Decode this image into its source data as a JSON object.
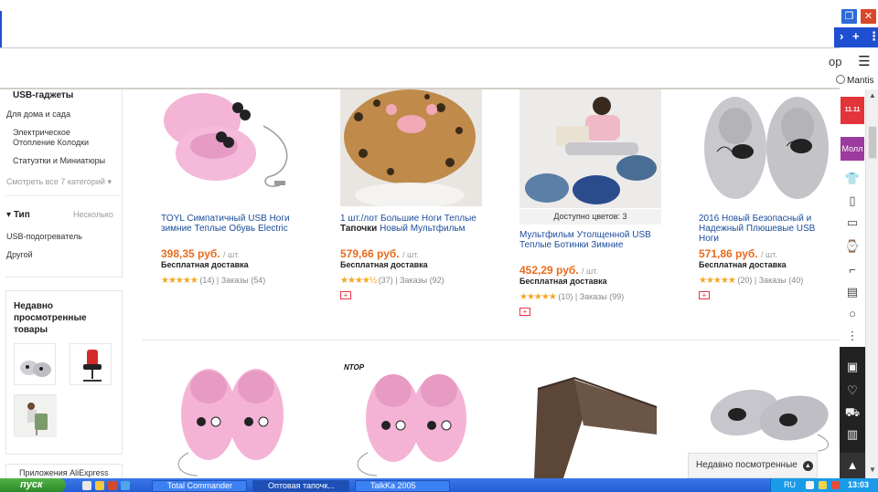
{
  "browser": {
    "menu_fragment": "ор",
    "restore_icon": "restore-icon",
    "close_icon": "close-icon",
    "nav": {
      "next": "›",
      "plus": "+",
      "more": "⋮"
    },
    "hamburger": "☰",
    "mantis_label": "Mantis",
    "accent": "#1f4fd1"
  },
  "left_filters": {
    "usb_gadgets": "USB-гаджеты",
    "home_garden": "Для дома и сада",
    "electric_heating": "Электрическое Отопление Колодки",
    "statuettes": "Статуэтки и Миниатюры",
    "see_all": "Смотреть все 7 категорий",
    "type_header": "Тип",
    "type_value": "Несколько",
    "type_options": [
      "USB-подогреватель",
      "Другой"
    ]
  },
  "recent": {
    "title": "Недавно просмотренные товары",
    "app_label": "Приложения AliExpress"
  },
  "right_rail": {
    "promo_red": "11.11",
    "promo_purple": "Молл"
  },
  "products": [
    {
      "title": "TOYL Симпатичный USB Ноги зимние Теплые Обувь Electric",
      "price": "398,35 руб.",
      "unit": "/ шт.",
      "shipping": "Бесплатная доставка",
      "rating_count": "(14)",
      "orders": "Заказы (54)",
      "rating": 5
    },
    {
      "title_pre": "1 шт./лот Большие Ноги Теплые",
      "title_bold": "Тапочки",
      "title_post": "Новый Мультфильм",
      "price": "579,66 руб.",
      "unit": "/ шт.",
      "shipping": "Бесплатная доставка",
      "rating_count": "(37)",
      "orders": "Заказы (92)",
      "rating": 4.5
    },
    {
      "colors": "Доступно цветов: 3",
      "title": "Мультфильм Утолщенной USB Теплые Ботинки Зимние",
      "price": "452,29 руб.",
      "unit": "/ шт.",
      "shipping": "Бесплатная доставка",
      "rating_count": "(10)",
      "orders": "Заказы (99)",
      "rating": 5
    },
    {
      "title": "2016 Новый Безопасный и Надежный Плюшевые USB Ноги",
      "price": "571,86 руб.",
      "unit": "/ шт.",
      "shipping": "Бесплатная доставка",
      "rating_count": "(20)",
      "orders": "Заказы (40)",
      "rating": 5
    }
  ],
  "second_row": {
    "brand_logo_text": "NTOP"
  },
  "recent_toast": "Недавно посмотренные",
  "taskbar": {
    "start": "пуск",
    "tasks": [
      "Total Commander",
      "Оптовая тапочк...",
      "TalkKa 2005"
    ],
    "lang": "RU",
    "time": "13:03"
  }
}
